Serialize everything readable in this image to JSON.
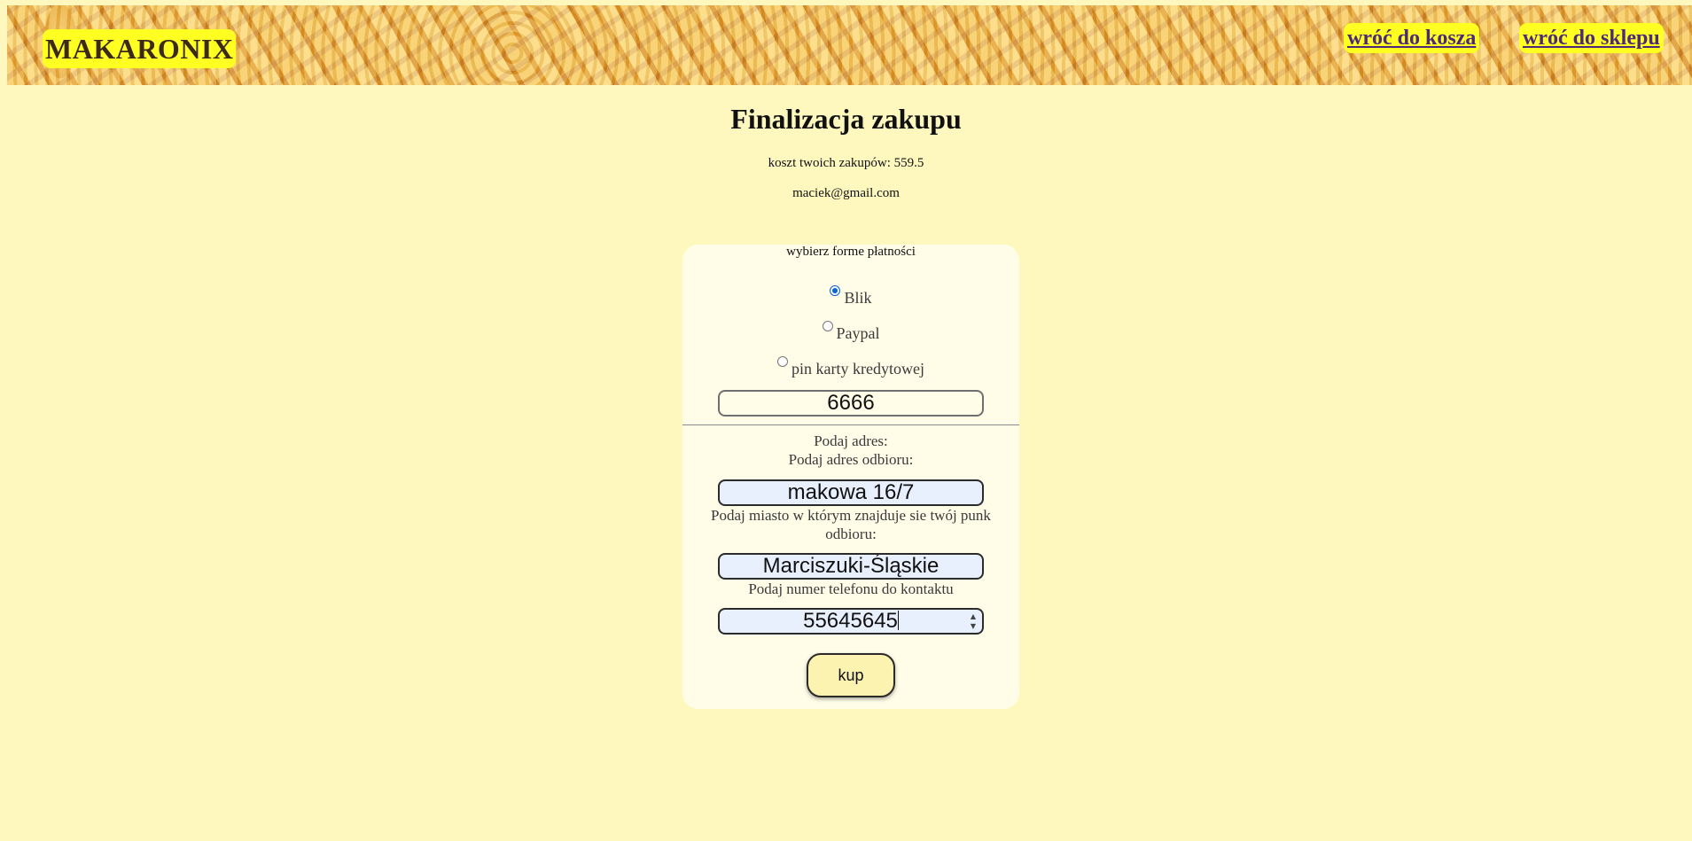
{
  "header": {
    "logo": "MAKARONIX",
    "nav": {
      "basket_label": "wróć do kosza",
      "shop_label": "wróć do sklepu"
    }
  },
  "main": {
    "title": "Finalizacja zakupu",
    "cost_text": "koszt twoich zakupów: 559.5",
    "email": "maciek@gmail.com"
  },
  "payment": {
    "heading": "wybierz forme płatności",
    "options": [
      {
        "label": "Blik",
        "checked": true
      },
      {
        "label": "Paypal",
        "checked": false
      },
      {
        "label": "pin karty kredytowej",
        "checked": false
      }
    ],
    "pin_value": "6666"
  },
  "address": {
    "label_address": "Podaj adres:",
    "label_pickup": "Podaj adres odbioru:",
    "pickup_value": "makowa 16/7",
    "label_city": "Podaj miasto w którym znajduje sie twój punk odbioru:",
    "city_value": "Marciszuki-Śląskie",
    "label_phone": "Podaj numer telefonu do kontaktu",
    "phone_value": "55645645"
  },
  "actions": {
    "buy_label": "kup"
  },
  "colors": {
    "page_background": "#fef8be",
    "card_background": "#fffde8",
    "highlight_yellow": "#ffff22",
    "link_color": "#4b2a7a",
    "autofill_blue": "#e8f0fe",
    "radio_accent": "#0b63d6"
  }
}
